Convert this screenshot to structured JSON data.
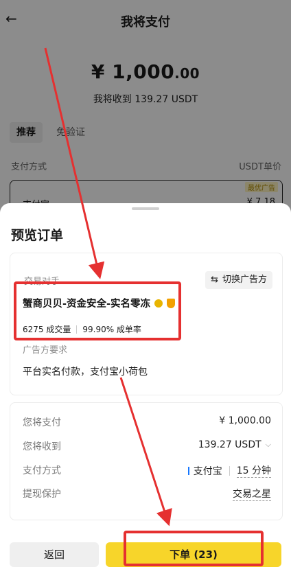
{
  "header": {
    "back_icon": "left-arrow-icon",
    "title": "我将支付"
  },
  "payment": {
    "amount_main": "¥ 1,000",
    "amount_cents": ".00",
    "receive_text": "我将收到 139.27 USDT"
  },
  "tabs": {
    "recommend": "推荐",
    "no_verify": "免验证"
  },
  "list_header": {
    "method": "支付方式",
    "price": "USDT单价"
  },
  "ad_card": {
    "badge": "最优广告",
    "method": "支付宝",
    "price": "¥ 7.18"
  },
  "sheet": {
    "title": "预览订单",
    "counterparty_label": "交易对手",
    "switch_label": "切换广告方",
    "merchant_name": "蟹商贝贝-资金安全-实名零冻",
    "volume": "6275 成交量",
    "rate": "99.90% 成单率",
    "requirement_label": "广告方要求",
    "requirement_text": "平台实名付款，支付宝小荷包",
    "details": {
      "pay_label": "您将支付",
      "pay_value": "¥ 1,000.00",
      "receive_label": "您将收到",
      "receive_value": "139.27 USDT",
      "method_label": "支付方式",
      "method_value": "支付宝",
      "method_time": "15 分钟",
      "protect_label": "提现保护",
      "protect_value": "交易之星"
    },
    "back_button": "返回",
    "order_button": "下单 (23)"
  },
  "colors": {
    "accent": "#f7d52a",
    "annotation": "#e53030"
  }
}
